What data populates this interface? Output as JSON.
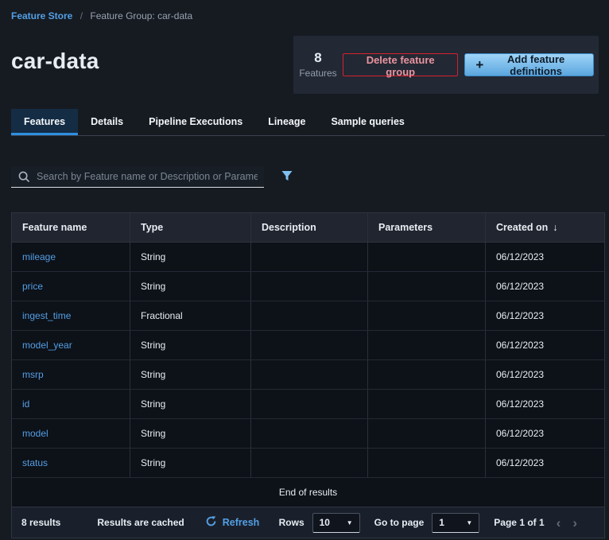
{
  "breadcrumb": {
    "link": "Feature Store",
    "separator": "/",
    "current": "Feature Group: car-data"
  },
  "header": {
    "title": "car-data",
    "stat": {
      "value": "8",
      "label": "Features"
    },
    "delete_button": "Delete feature group",
    "add_button": "Add feature definitions"
  },
  "tabs": [
    {
      "label": "Features",
      "active": true
    },
    {
      "label": "Details",
      "active": false
    },
    {
      "label": "Pipeline Executions",
      "active": false
    },
    {
      "label": "Lineage",
      "active": false
    },
    {
      "label": "Sample queries",
      "active": false
    }
  ],
  "search": {
    "placeholder": "Search by Feature name or Description or Paramete"
  },
  "icons": {
    "plus": "+",
    "sort_desc": "↓",
    "caret_down": "▼",
    "chevron_left": "‹",
    "chevron_right": "›",
    "search": "magnifier",
    "filter": "funnel",
    "refresh": "circular-arrow"
  },
  "table": {
    "columns": [
      "Feature name",
      "Type",
      "Description",
      "Parameters",
      "Created on"
    ],
    "rows": [
      {
        "feature_name": "mileage",
        "type": "String",
        "description": "",
        "parameters": "",
        "created_on": "06/12/2023"
      },
      {
        "feature_name": "price",
        "type": "String",
        "description": "",
        "parameters": "",
        "created_on": "06/12/2023"
      },
      {
        "feature_name": "ingest_time",
        "type": "Fractional",
        "description": "",
        "parameters": "",
        "created_on": "06/12/2023"
      },
      {
        "feature_name": "model_year",
        "type": "String",
        "description": "",
        "parameters": "",
        "created_on": "06/12/2023"
      },
      {
        "feature_name": "msrp",
        "type": "String",
        "description": "",
        "parameters": "",
        "created_on": "06/12/2023"
      },
      {
        "feature_name": "id",
        "type": "String",
        "description": "",
        "parameters": "",
        "created_on": "06/12/2023"
      },
      {
        "feature_name": "model",
        "type": "String",
        "description": "",
        "parameters": "",
        "created_on": "06/12/2023"
      },
      {
        "feature_name": "status",
        "type": "String",
        "description": "",
        "parameters": "",
        "created_on": "06/12/2023"
      }
    ],
    "end_message": "End of results"
  },
  "footer": {
    "results_count": "8 results",
    "cache_status": "Results are cached",
    "refresh_label": "Refresh",
    "rows_label": "Rows",
    "rows_per_page": "10",
    "goto_label": "Go to page",
    "current_page": "1",
    "page_status": "Page 1 of 1"
  },
  "colors": {
    "page_bg": "#161b22",
    "panel_bg": "#222834",
    "row_bg": "#0d1118",
    "header_row_bg": "#20252f",
    "footer_bg": "#1a202b",
    "accent_blue": "#539fe5",
    "primary_button_blue": "#7fc0f0",
    "danger_red": "#d7222f",
    "active_tab_bg": "#142c44",
    "tab_underline_blue": "#2e8fe0"
  }
}
